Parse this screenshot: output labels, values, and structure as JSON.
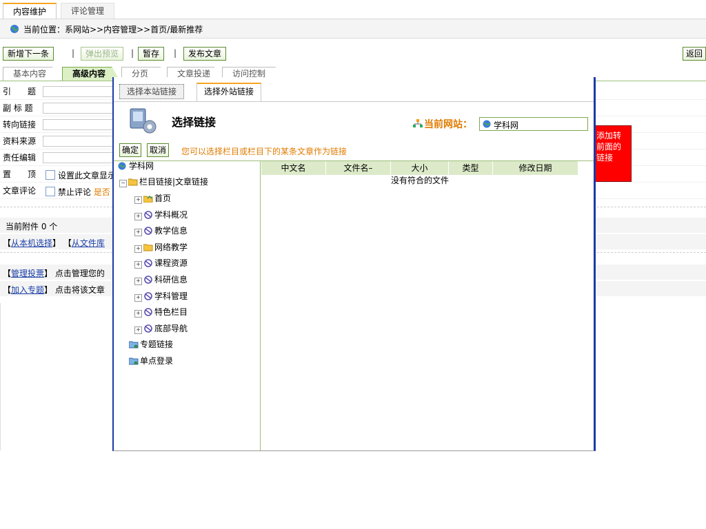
{
  "top_tabs": [
    {
      "label": "内容维护",
      "active": true
    },
    {
      "label": "评论管理",
      "active": false
    }
  ],
  "breadcrumb": {
    "text": "当前位置：系网站>>内容管理>>首页/最新推荐"
  },
  "toolbar": {
    "new_next": "新增下一条",
    "popup_preview": "弹出预览",
    "save_draft": "暂存",
    "publish": "发布文章",
    "back": "返回",
    "separator": "|"
  },
  "sub_tabs": [
    {
      "label": "基本内容",
      "active": false
    },
    {
      "label": "高级内容",
      "active": true
    },
    {
      "label": "分页",
      "active": false
    },
    {
      "label": "文章投递",
      "active": false
    },
    {
      "label": "访问控制",
      "active": false
    }
  ],
  "form": {
    "rows": [
      {
        "label": "引　　题"
      },
      {
        "label": "副 标 题"
      },
      {
        "label": "转向链接"
      },
      {
        "label": "资料来源"
      },
      {
        "label": "责任编辑"
      }
    ],
    "top_label": "置　　顶",
    "top_checkbox": "设置此文章显示",
    "comment_label": "文章评论",
    "comment_checkbox": "禁止评论",
    "comment_extra": "是否",
    "attachments": "当前附件 0 个",
    "from_local": "从本机选择",
    "from_library": "从文件库",
    "bracket_open": "【",
    "bracket_close": "】",
    "manage_vote": "管理投票",
    "manage_vote_desc": "点击管理您的",
    "add_topic": "加入专题",
    "add_topic_desc": "点击将该文章"
  },
  "red_hint": {
    "text": "添加转\n前面的\n链接"
  },
  "dialog": {
    "tabs": [
      {
        "label": "选择本站链接",
        "active": false
      },
      {
        "label": "选择外站链接",
        "active": true
      }
    ],
    "title": "选择链接",
    "current_site_label": "当前网站：",
    "current_site_value": "学科网",
    "ok": "确定",
    "cancel": "取消",
    "hint": "您可以选择栏目或栏目下的某条文章作为链接",
    "tree": {
      "root": "学科网",
      "group": "栏目链接|文章链接",
      "items": [
        "首页",
        "学科概况",
        "教学信息",
        "网络教学",
        "课程资源",
        "科研信息",
        "学科管理",
        "特色栏目",
        "底部导航"
      ],
      "special": "专题链接",
      "login": "单点登录"
    },
    "table": {
      "headers": [
        "中文名",
        "文件名–",
        "大小",
        "类型",
        "修改日期"
      ],
      "empty": "没有符合的文件"
    }
  },
  "colors": {
    "active_tab_accent": "#f7a520",
    "dialog_border": "#1b3aa8",
    "red_hint_bg": "#ff0000",
    "hint_orange": "#e07b00",
    "header_green": "#dceac9"
  }
}
